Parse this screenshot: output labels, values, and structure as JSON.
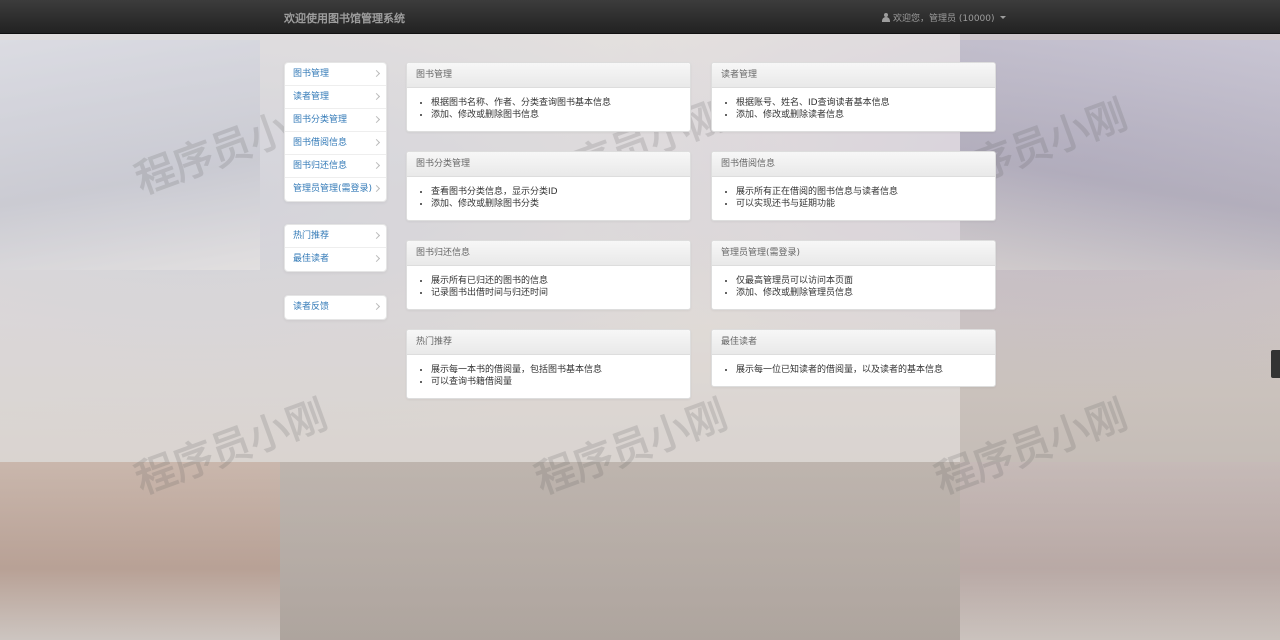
{
  "navbar": {
    "brand": "欢迎使用图书馆管理系统",
    "user_label": "欢迎您，管理员 (10000)"
  },
  "sidebar": {
    "group1": [
      {
        "label": "图书管理"
      },
      {
        "label": "读者管理"
      },
      {
        "label": "图书分类管理"
      },
      {
        "label": "图书借阅信息"
      },
      {
        "label": "图书归还信息"
      },
      {
        "label": "管理员管理(需登录)"
      }
    ],
    "group2": [
      {
        "label": "热门推荐"
      },
      {
        "label": "最佳读者"
      }
    ],
    "group3": [
      {
        "label": "读者反馈"
      }
    ]
  },
  "panels": [
    {
      "title": "图书管理",
      "items": [
        "根据图书名称、作者、分类查询图书基本信息",
        "添加、修改或删除图书信息"
      ]
    },
    {
      "title": "读者管理",
      "items": [
        "根据账号、姓名、ID查询读者基本信息",
        "添加、修改或删除读者信息"
      ]
    },
    {
      "title": "图书分类管理",
      "items": [
        "查看图书分类信息，显示分类ID",
        "添加、修改或删除图书分类"
      ]
    },
    {
      "title": "图书借阅信息",
      "items": [
        "展示所有正在借阅的图书信息与读者信息",
        "可以实现还书与延期功能"
      ]
    },
    {
      "title": "图书归还信息",
      "items": [
        "展示所有已归还的图书的信息",
        "记录图书出借时间与归还时间"
      ]
    },
    {
      "title": "管理员管理(需登录)",
      "items": [
        "仅最高管理员可以访问本页面",
        "添加、修改或删除管理员信息"
      ]
    },
    {
      "title": "热门推荐",
      "items": [
        "展示每一本书的借阅量，包括图书基本信息",
        "可以查询书籍借阅量"
      ]
    },
    {
      "title": "最佳读者",
      "items": [
        "展示每一位已知读者的借阅量，以及读者的基本信息"
      ]
    }
  ],
  "watermark": "程序员小刚"
}
